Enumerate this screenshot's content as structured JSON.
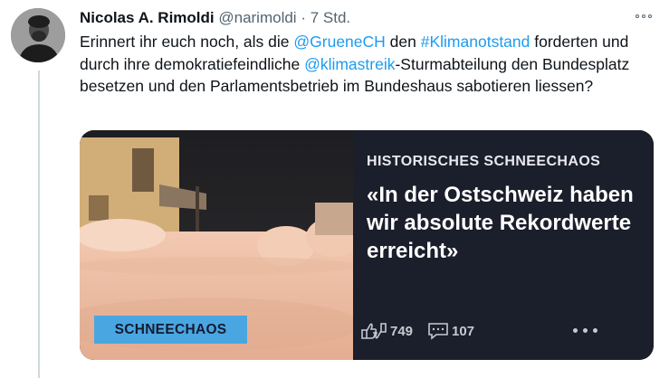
{
  "tweet": {
    "author_name": "Nicolas A. Rimoldi",
    "handle": "@narimoldi",
    "separator": "·",
    "time": "7 Std.",
    "text_parts": [
      "Erinnert ihr euch noch, als die ",
      "@GrueneCH",
      " den ",
      "#Klimanotstand",
      " forderten und durch ihre demokratiefeindliche ",
      "@klimastreik",
      "-Sturmabteilung den Bundesplatz besetzen und den Parlamentsbetrieb im Bundeshaus sabotieren liessen?"
    ]
  },
  "card": {
    "kicker": "HISTORISCHES SCHNEECHAOS",
    "headline": "«In der Ostschweiz haben wir absolute Rekordwerte erreicht»",
    "badge": "SCHNEECHAOS",
    "likes": "749",
    "comments": "107"
  },
  "colors": {
    "link": "#1d9bf0",
    "card_bg": "#1b1e2b",
    "badge_bg": "#4aa6e0"
  },
  "icons": [
    "more-icon",
    "thumbs-icon",
    "comment-icon",
    "card-more-icon"
  ]
}
